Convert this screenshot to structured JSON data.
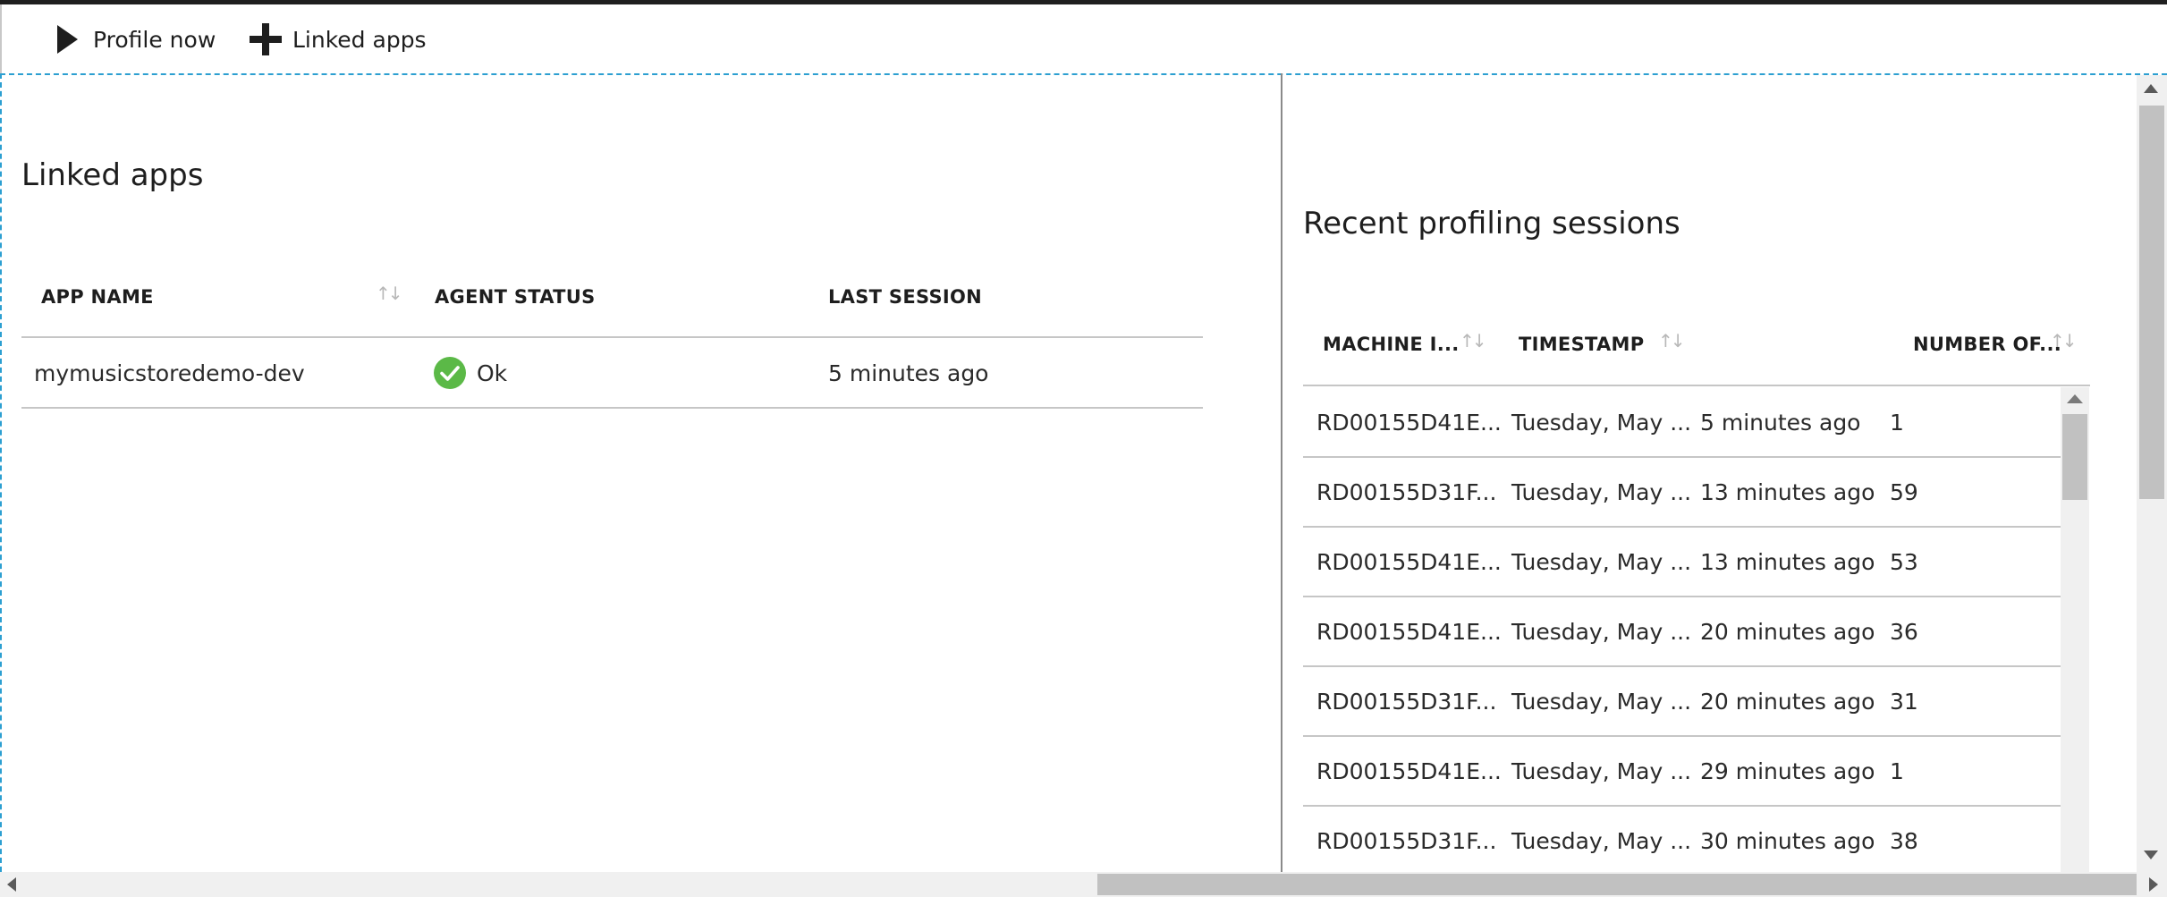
{
  "toolbar": {
    "profile_now": "Profile now",
    "linked_apps": "Linked apps"
  },
  "linked_apps": {
    "title": "Linked apps",
    "columns": [
      "APP NAME",
      "AGENT STATUS",
      "LAST SESSION"
    ],
    "rows": [
      {
        "app_name": "mymusicstoredemo-dev",
        "agent_status": "Ok",
        "last_session": "5 minutes ago"
      }
    ]
  },
  "sessions": {
    "title": "Recent profiling sessions",
    "columns": [
      "MACHINE I...",
      "TIMESTAMP",
      "NUMBER OF..."
    ],
    "rows": [
      {
        "machine": "RD00155D41E...",
        "timestamp": "Tuesday, May ...",
        "ago": "5 minutes ago",
        "count": "1"
      },
      {
        "machine": "RD00155D31F...",
        "timestamp": "Tuesday, May ...",
        "ago": "13 minutes ago",
        "count": "59"
      },
      {
        "machine": "RD00155D41E...",
        "timestamp": "Tuesday, May ...",
        "ago": "13 minutes ago",
        "count": "53"
      },
      {
        "machine": "RD00155D41E...",
        "timestamp": "Tuesday, May ...",
        "ago": "20 minutes ago",
        "count": "36"
      },
      {
        "machine": "RD00155D31F...",
        "timestamp": "Tuesday, May ...",
        "ago": "20 minutes ago",
        "count": "31"
      },
      {
        "machine": "RD00155D41E...",
        "timestamp": "Tuesday, May ...",
        "ago": "29 minutes ago",
        "count": "1"
      },
      {
        "machine": "RD00155D31F...",
        "timestamp": "Tuesday, May ...",
        "ago": "30 minutes ago",
        "count": "38"
      }
    ]
  },
  "colors": {
    "accent_dashed": "#2c9fd1",
    "ok_green": "#5bb947",
    "divider": "#8a8a8a"
  },
  "icons": {
    "profile_now": "play-icon",
    "linked_apps": "plus-icon",
    "agent_status_ok": "check-circle-icon"
  }
}
